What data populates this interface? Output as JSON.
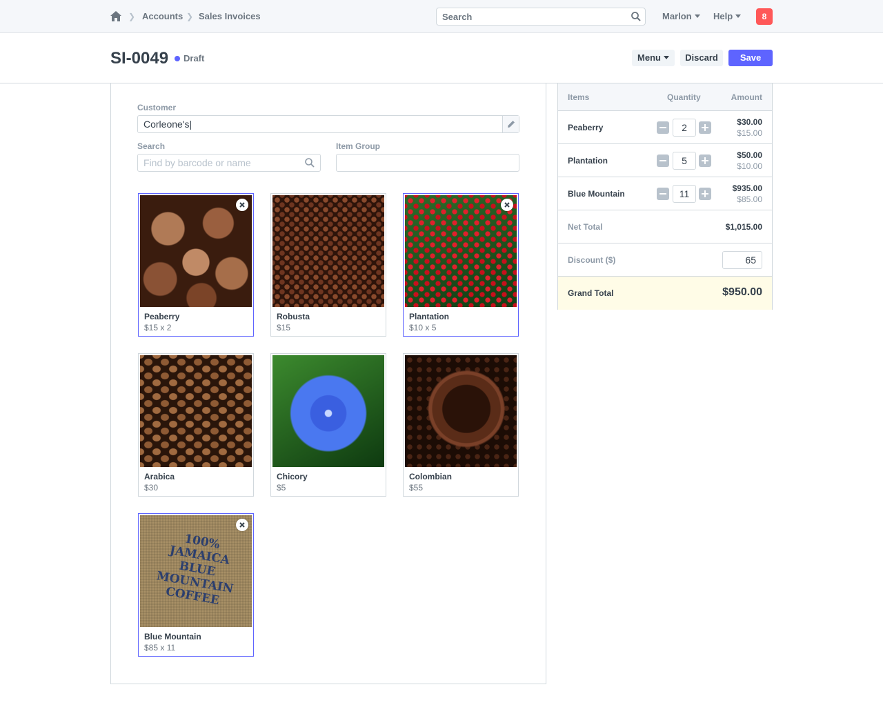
{
  "nav": {
    "breadcrumbs": [
      "Accounts",
      "Sales Invoices"
    ],
    "search_label": "Search",
    "user_label": "Marlon",
    "help_label": "Help",
    "notification_count": "8"
  },
  "header": {
    "title": "SI-0049",
    "status": "Draft",
    "menu_label": "Menu",
    "discard_label": "Discard",
    "save_label": "Save"
  },
  "form": {
    "customer_label": "Customer",
    "customer_value": "Corleone's|",
    "search_label": "Search",
    "search_placeholder": "Find by barcode or name",
    "item_group_label": "Item Group",
    "item_group_value": ""
  },
  "products": [
    {
      "name": "Peaberry",
      "price": "$15 x 2",
      "selected": true
    },
    {
      "name": "Robusta",
      "price": "$15",
      "selected": false
    },
    {
      "name": "Plantation",
      "price": "$10 x 5",
      "selected": true
    },
    {
      "name": "Arabica",
      "price": "$30",
      "selected": false
    },
    {
      "name": "Chicory",
      "price": "$5",
      "selected": false
    },
    {
      "name": "Colombian",
      "price": "$55",
      "selected": false
    },
    {
      "name": "Blue Mountain",
      "price": "$85 x 11",
      "selected": true
    }
  ],
  "cart": {
    "col_items": "Items",
    "col_quantity": "Quantity",
    "col_amount": "Amount",
    "lines": [
      {
        "name": "Peaberry",
        "qty": "2",
        "amount": "$30.00",
        "rate": "$15.00"
      },
      {
        "name": "Plantation",
        "qty": "5",
        "amount": "$50.00",
        "rate": "$10.00"
      },
      {
        "name": "Blue Mountain",
        "qty": "11",
        "amount": "$935.00",
        "rate": "$85.00"
      }
    ],
    "net_total_label": "Net Total",
    "net_total": "$1,015.00",
    "discount_label": "Discount ($)",
    "discount": "65",
    "grand_total_label": "Grand Total",
    "grand_total": "$950.00"
  },
  "colors": {
    "accent": "#5e64ff",
    "badge": "#ff5858",
    "grand_total_bg": "#fffce7"
  }
}
